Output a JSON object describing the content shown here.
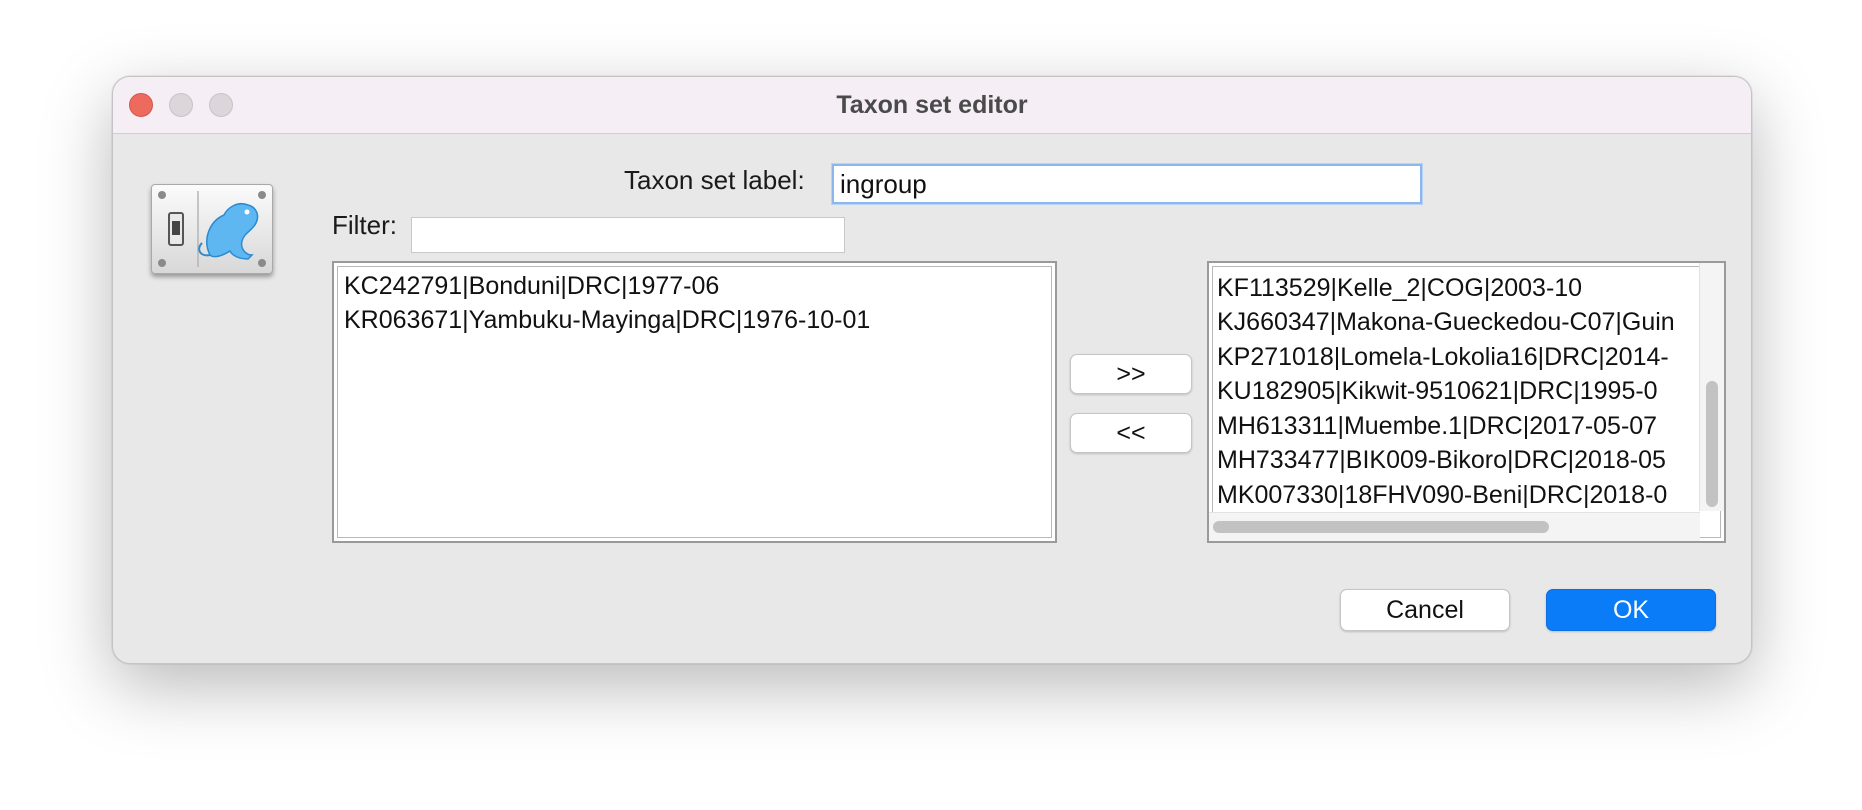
{
  "window": {
    "title": "Taxon set editor"
  },
  "label_field": {
    "label": "Taxon set label:",
    "value": "ingroup"
  },
  "filter": {
    "label": "Filter:",
    "value": ""
  },
  "left_list": {
    "items": [
      "KC242791|Bonduni|DRC|1977-06",
      "KR063671|Yambuku-Mayinga|DRC|1976-10-01"
    ]
  },
  "transfer_buttons": {
    "add_label": ">>",
    "remove_label": "<<"
  },
  "right_list": {
    "items": [
      "KF113529|Kelle_2|COG|2003-10",
      "KJ660347|Makona-Gueckedou-C07|Guin",
      "KP271018|Lomela-Lokolia16|DRC|2014-",
      "KU182905|Kikwit-9510621|DRC|1995-0",
      "MH613311|Muembe.1|DRC|2017-05-07",
      "MH733477|BIK009-Bikoro|DRC|2018-05",
      "MK007330|18FHV090-Beni|DRC|2018-0"
    ]
  },
  "footer": {
    "cancel_label": "Cancel",
    "ok_label": "OK"
  },
  "colors": {
    "accent": "#0a7cf7",
    "close_button": "#ed6a5e",
    "titlebar": "#f5eef4",
    "window_bg": "#e8e8e8"
  },
  "icons": {
    "app_icon": "rat-with-switch-icon"
  }
}
